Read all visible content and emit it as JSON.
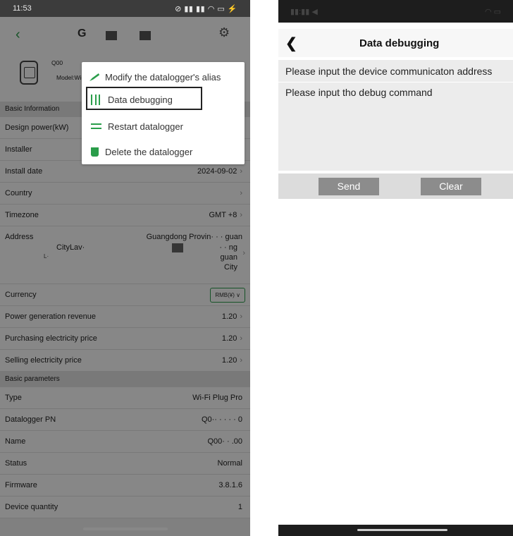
{
  "left": {
    "status_time": "11:53",
    "status_icons": "ℤ ᵢₗ ᵢₗ ≋ ▭ ⚡",
    "device_alias": "Q00",
    "device_model": "Model:Wi-",
    "sections": [
      "Basic Information",
      "Basic parameters"
    ],
    "rows": {
      "design_power": "Design power(kW)",
      "installer": "Installer",
      "install_date": "Install date",
      "install_date_value": "2024-09-02",
      "country": "Country",
      "timezone": "Timezone",
      "timezone_value": "GMT +8",
      "address": "Address",
      "address_line1": "Guangdong Provin· · · guan",
      "address_line2": "CityLav·",
      "address_line3": "L·",
      "address_r2": "· · ng",
      "address_r3": "guan",
      "address_r4": "City",
      "currency": "Currency",
      "currency_value": "RMB(¥)",
      "power_revenue": "Power generation revenue",
      "power_revenue_value": "1.20",
      "purchasing_price": "Purchasing electricity price",
      "purchasing_price_value": "1.20",
      "selling_price": "Selling electricity price",
      "selling_price_value": "1.20",
      "type": "Type",
      "type_value": "Wi-Fi Plug Pro",
      "datalogger_pn": "Datalogger PN",
      "datalogger_pn_value": "Q0·· · · · · 0",
      "name": "Name",
      "name_value": "Q00· · .00",
      "status": "Status",
      "status_value": "Normal",
      "firmware": "Firmware",
      "firmware_value": "3.8.1.6",
      "device_quantity": "Device quantity",
      "device_quantity_value": "1"
    },
    "menu": {
      "modify_alias": "Modify the datalogger's alias",
      "data_debugging": "Data debugging",
      "restart": "Restart datalogger",
      "delete": "Delete the datalogger"
    },
    "accent_color": "#2a9d4a"
  },
  "right": {
    "title": "Data debugging",
    "address_placeholder": "Please input the device communicaton address",
    "command_placeholder": "Please input tho debug command",
    "send_label": "Send",
    "clear_label": "Clear"
  }
}
